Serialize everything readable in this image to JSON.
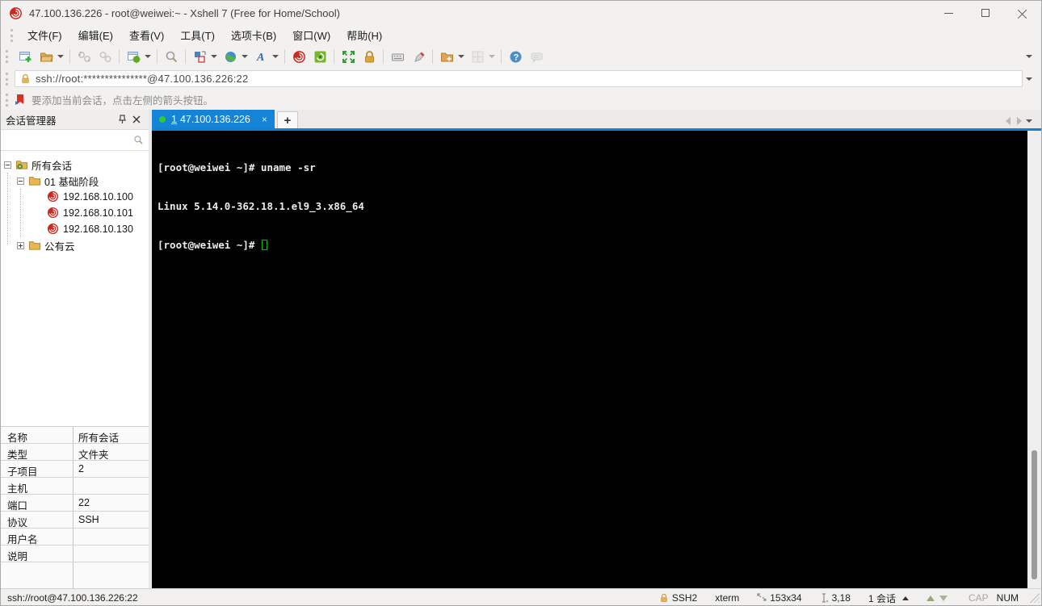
{
  "window": {
    "title": "47.100.136.226 - root@weiwei:~ - Xshell 7 (Free for Home/School)"
  },
  "menubar": {
    "items": [
      "文件(F)",
      "编辑(E)",
      "查看(V)",
      "工具(T)",
      "选项卡(B)",
      "窗口(W)",
      "帮助(H)"
    ]
  },
  "toolbar": {
    "items": [
      "new-session",
      "open-folder",
      "disconnect",
      "reconnect",
      "session-properties",
      "find",
      "layout",
      "encoding-globe",
      "font",
      "xshell",
      "xftp",
      "fullscreen",
      "lock-screen",
      "virtual-keyboard",
      "compose",
      "new-session-folder",
      "tile-windows",
      "help",
      "feedback"
    ]
  },
  "addressbar": {
    "url": "ssh://root:***************@47.100.136.226:22"
  },
  "infobar": {
    "message": "要添加当前会话，点击左侧的箭头按钮。"
  },
  "session_manager": {
    "title": "会话管理器",
    "tree": {
      "root_label": "所有会话",
      "folder_label": "01 基础阶段",
      "sessions": [
        "192.168.10.100",
        "192.168.10.101",
        "192.168.10.130"
      ],
      "collapsed_label": "公有云"
    },
    "properties": [
      {
        "label": "名称",
        "value": "所有会话"
      },
      {
        "label": "类型",
        "value": "文件夹"
      },
      {
        "label": "子项目",
        "value": "2"
      },
      {
        "label": "主机",
        "value": ""
      },
      {
        "label": "端口",
        "value": "22"
      },
      {
        "label": "协议",
        "value": "SSH"
      },
      {
        "label": "用户名",
        "value": ""
      },
      {
        "label": "说明",
        "value": ""
      }
    ]
  },
  "tabbar": {
    "active_tab": {
      "index": "1",
      "label": "47.100.136.226",
      "close": "×"
    },
    "new_tab": "+"
  },
  "terminal": {
    "lines": [
      "[root@weiwei ~]# uname -sr",
      "Linux 5.14.0-362.18.1.el9_3.x86_64"
    ],
    "prompt": "[root@weiwei ~]# "
  },
  "statusbar": {
    "url": "ssh://root@47.100.136.226:22",
    "protocol": "SSH2",
    "terminal_type": "xterm",
    "screen_size": "153x34",
    "cursor_position": "3,18",
    "session_count": "1 会话",
    "caps_indicator": "CAP",
    "num_indicator": "NUM"
  },
  "colors": {
    "accent_blue": "#1583d6",
    "tab_underline": "#0f80d2",
    "terminal_bg": "#000000",
    "terminal_text": "#ececec",
    "cursor_green": "#17b317",
    "session_icon_red": "#cf2821",
    "folder_tan": "#e9b54d",
    "lock_orange": "#dfa33c"
  }
}
